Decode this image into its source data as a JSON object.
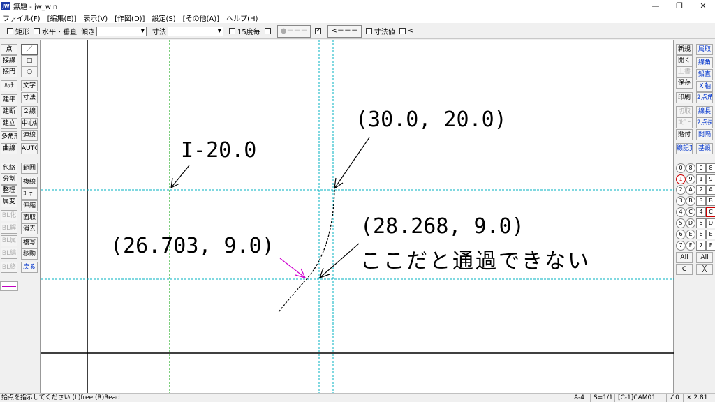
{
  "window": {
    "title": "無題 - jw_win",
    "icon_text": "JW",
    "minimize": "—",
    "maximize": "❐",
    "close": "✕"
  },
  "menu": [
    "ファイル(F)",
    "[編集(E)]",
    "表示(V)",
    "[作図(D)]",
    "設定(S)",
    "[その他(A)]",
    "ヘルプ(H)"
  ],
  "toolbar": {
    "rect_label": "矩形",
    "horiz_vert_label": "水平・垂直",
    "tilt_label": "傾き",
    "dim_label": "寸法",
    "deg15_label": "15度毎",
    "point_btn": "●－－－",
    "arrow_btn": "<－－－",
    "dimval_label": "寸法値",
    "lt_label": "<"
  },
  "left_palette": {
    "col1": [
      "点",
      "接線",
      "接円",
      "ﾊｯﾁ",
      "建平",
      "建断",
      "建立",
      "多角形",
      "曲線",
      "包絡",
      "分割",
      "整理",
      "属変",
      "BL化",
      "BL解",
      "BL属",
      "BL編",
      "BL終"
    ],
    "col2": [
      "／",
      "□",
      "○",
      "文字",
      "寸法",
      "２線",
      "中心線",
      "連線",
      "AUTO",
      "範囲",
      "複線",
      "ｺｰﾅｰ",
      "伸縮",
      "面取",
      "消去",
      "複写",
      "移動",
      "戻る"
    ]
  },
  "right_palette": {
    "col1": [
      "新規",
      "開く",
      "上書",
      "保存",
      "印刷",
      "切取",
      "ｺﾋﾟｰ",
      "貼付",
      "線記変"
    ],
    "col2": [
      "属取",
      "線角",
      "鉛直",
      "Ｘ軸",
      "2点角",
      "線長",
      "2点長",
      "間隔",
      "基設"
    ],
    "layer_groups_left": [
      "0",
      "1",
      "2",
      "3",
      "4",
      "5",
      "6",
      "7"
    ],
    "layer_circle_right": [
      "8",
      "9",
      "A",
      "B",
      "C",
      "D",
      "E",
      "F"
    ],
    "layer_sq_left": [
      "0",
      "1",
      "2",
      "3",
      "4",
      "5",
      "6",
      "7"
    ],
    "layer_sq_right": [
      "8",
      "9",
      "A",
      "B",
      "C",
      "D",
      "E",
      "F"
    ],
    "all_label": "All",
    "c_label": "C",
    "x_label": "╳"
  },
  "canvas": {
    "label_i20": "I-20.0",
    "label_30_20": "(30.0, 20.0)",
    "label_28_9": "(28.268, 9.0)",
    "label_26_9": "(26.703, 9.0)",
    "label_note": "ここだと通過できない"
  },
  "status": {
    "message": "始点を指示してください (L)free (R)Read",
    "paper": "A-4",
    "scale": "S=1/1",
    "layer": "[C-1]CAM01",
    "angle": "∠0",
    "zoom": "× 2.81"
  },
  "colors": {
    "guide_green": "#00a000",
    "guide_cyan": "#00b0c0",
    "arrow_magenta": "#d000d0",
    "axis_black": "#000000"
  }
}
